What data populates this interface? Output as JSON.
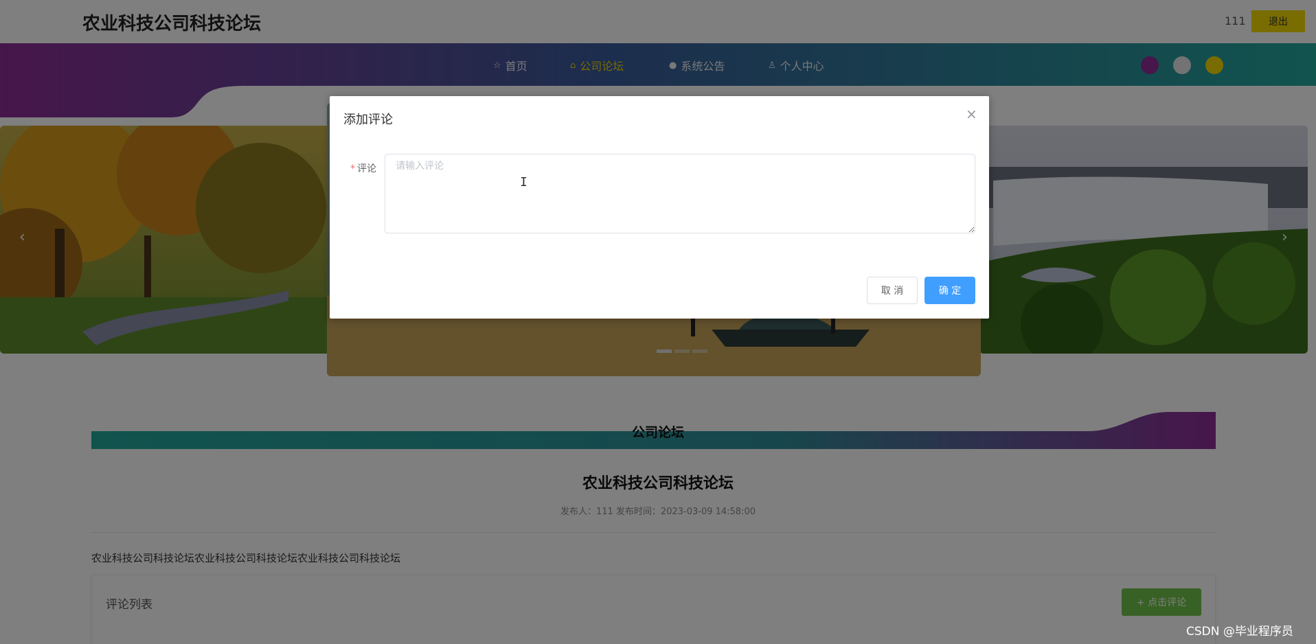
{
  "header": {
    "site_title": "农业科技公司科技论坛",
    "username": "111",
    "logout_label": "退出"
  },
  "nav": {
    "items": [
      {
        "label": "首页",
        "icon": "star-icon"
      },
      {
        "label": "公司论坛",
        "icon": "lock-icon",
        "active": true
      },
      {
        "label": "系统公告",
        "icon": "info-circle-icon"
      },
      {
        "label": "个人中心",
        "icon": "user-icon"
      }
    ]
  },
  "theme": {
    "primary_teal": "#23a89c",
    "gradient_purple": "#8e2d96",
    "accent_yellow": "#f2d900",
    "dot_colors": [
      "#8e2d96",
      "#e6e6e6",
      "#f2d900"
    ],
    "button_blue": "#409eff",
    "button_green": "#71c24a"
  },
  "carousel": {
    "prev_label": "‹",
    "next_label": "›",
    "slides": [
      "autumn-forest",
      "river-boat",
      "waterfall-moss"
    ],
    "active_index": 1
  },
  "forum": {
    "section_title": "公司论坛",
    "post_title": "农业科技公司科技论坛",
    "post_meta": "发布人：111  发布时间：2023-03-09 14:58:00",
    "post_content": "农业科技公司科技论坛农业科技公司科技论坛农业科技公司科技论坛",
    "comments_title": "评论列表",
    "add_comment_label": "+ 点击评论"
  },
  "dialog": {
    "title": "添加评论",
    "close_label": "×",
    "field_label": "评论",
    "field_required_mark": "*",
    "field_placeholder": "请输入评论",
    "field_value": "",
    "cancel_label": "取 消",
    "confirm_label": "确 定"
  },
  "watermark": "CSDN @毕业程序员"
}
